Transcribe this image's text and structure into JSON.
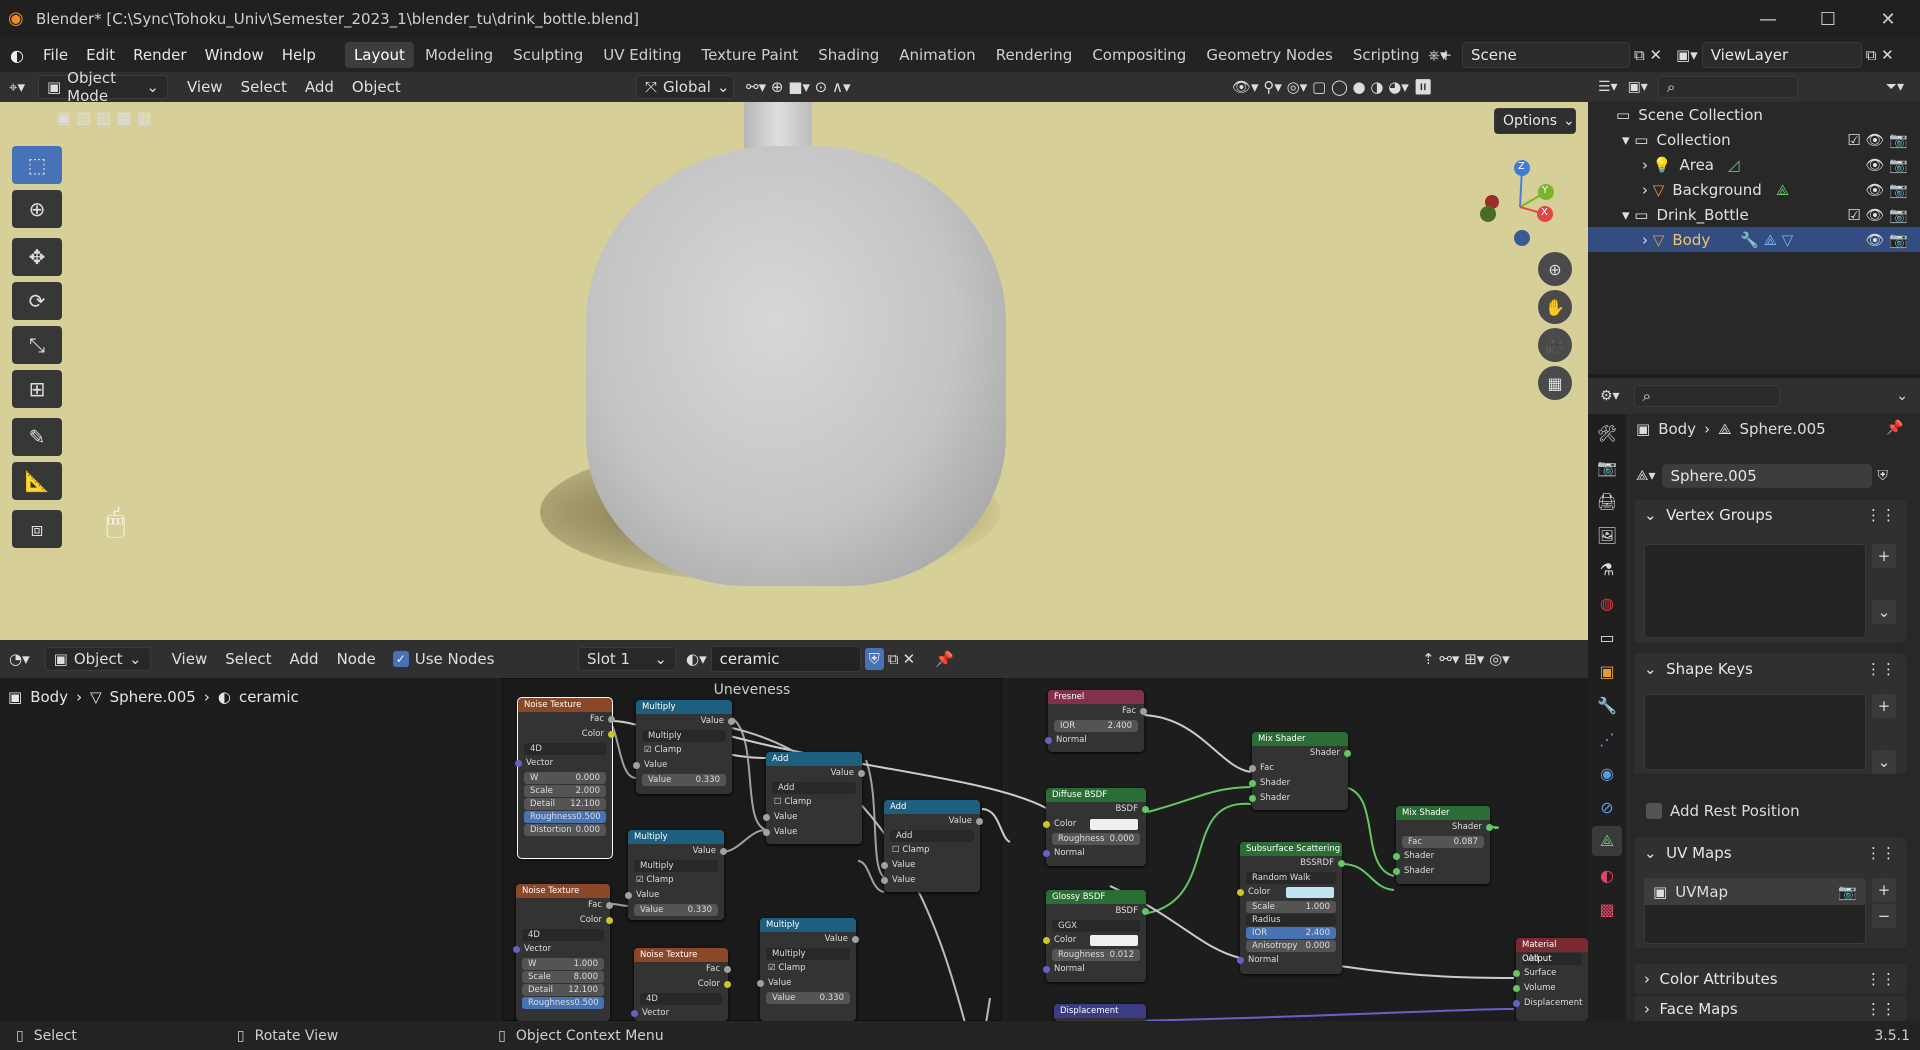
{
  "titlebar": {
    "title": "Blender* [C:\\Sync\\Tohoku_Univ\\Semester_2023_1\\blender_tu\\drink_bottle.blend]"
  },
  "menu": [
    "File",
    "Edit",
    "Render",
    "Window",
    "Help"
  ],
  "workspaces": [
    "Layout",
    "Modeling",
    "Sculpting",
    "UV Editing",
    "Texture Paint",
    "Shading",
    "Animation",
    "Rendering",
    "Compositing",
    "Geometry Nodes",
    "Scripting"
  ],
  "scene": {
    "name": "Scene",
    "view_layer": "ViewLayer"
  },
  "viewport_header": {
    "mode": "Object Mode",
    "items": [
      "View",
      "Select",
      "Add",
      "Object"
    ],
    "transform": "Global",
    "options": "Options"
  },
  "gizmo": {
    "z": "Z",
    "y": "Y",
    "x": "X"
  },
  "node_header": {
    "mode": "Object",
    "items": [
      "View",
      "Select",
      "Add",
      "Node"
    ],
    "use_nodes": "Use Nodes",
    "slot": "Slot 1",
    "material": "ceramic"
  },
  "node_breadcrumb": [
    "Body",
    "Sphere.005",
    "ceramic"
  ],
  "frame_label": "Uneveness",
  "nodes": {
    "noise1": {
      "title": "Noise Texture",
      "out1": "Fac",
      "out2": "Color",
      "dim": "4D",
      "vec": "Vector",
      "w": [
        "W",
        "0.000"
      ],
      "scale": [
        "Scale",
        "2.000"
      ],
      "detail": [
        "Detail",
        "12.100"
      ],
      "rough": [
        "Roughness",
        "0.500"
      ],
      "dist": [
        "Distortion",
        "0.000"
      ]
    },
    "noise2": {
      "title": "Noise Texture",
      "out1": "Fac",
      "out2": "Color",
      "dim": "4D",
      "vec": "Vector",
      "w": [
        "W",
        "1.000"
      ],
      "scale": [
        "Scale",
        "8.000"
      ],
      "detail": [
        "Detail",
        "12.100"
      ],
      "rough": [
        "Roughness",
        "0.500"
      ]
    },
    "noise3": {
      "title": "Noise Texture",
      "out1": "Fac",
      "out2": "Color",
      "dim": "4D",
      "vec": "Vector"
    },
    "mul1": {
      "title": "Multiply",
      "out": "Value",
      "op": "Multiply",
      "clamp": "Clamp",
      "in": "Value",
      "val": [
        "Value",
        "0.330"
      ]
    },
    "mul2": {
      "title": "Multiply",
      "out": "Value",
      "op": "Multiply",
      "clamp": "Clamp",
      "in": "Value",
      "val": [
        "Value",
        "0.330"
      ]
    },
    "mul3": {
      "title": "Multiply",
      "out": "Value",
      "op": "Multiply",
      "clamp": "Clamp",
      "in": "Value",
      "val": [
        "Value",
        "0.330"
      ]
    },
    "add1": {
      "title": "Add",
      "out": "Value",
      "op": "Add",
      "clamp": "Clamp",
      "in1": "Value",
      "in2": "Value"
    },
    "add2": {
      "title": "Add",
      "out": "Value",
      "op": "Add",
      "clamp": "Clamp",
      "in1": "Value",
      "in2": "Value"
    },
    "fresnel": {
      "title": "Fresnel",
      "out": "Fac",
      "ior": [
        "IOR",
        "2.400"
      ],
      "normal": "Normal"
    },
    "diffuse": {
      "title": "Diffuse BSDF",
      "out": "BSDF",
      "color": "Color",
      "rough": [
        "Roughness",
        "0.000"
      ],
      "normal": "Normal"
    },
    "glossy": {
      "title": "Glossy BSDF",
      "out": "BSDF",
      "dist": "GGX",
      "color": "Color",
      "rough": [
        "Roughness",
        "0.012"
      ],
      "normal": "Normal"
    },
    "mix1": {
      "title": "Mix Shader",
      "out": "Shader",
      "fac": "Fac",
      "s1": "Shader",
      "s2": "Shader"
    },
    "mix2": {
      "title": "Mix Shader",
      "out": "Shader",
      "fac": [
        "Fac",
        "0.087"
      ],
      "s1": "Shader",
      "s2": "Shader"
    },
    "sss": {
      "title": "Subsurface Scattering",
      "out": "BSSRDF",
      "method": "Random Walk",
      "color": "Color",
      "scale": [
        "Scale",
        "1.000"
      ],
      "radius": "Radius",
      "ior": [
        "IOR",
        "2.400"
      ],
      "aniso": [
        "Anisotropy",
        "0.000"
      ],
      "normal": "Normal"
    },
    "output": {
      "title": "Material Output",
      "target": "All",
      "surface": "Surface",
      "volume": "Volume",
      "disp": "Displacement"
    },
    "displacement": {
      "title": "Displacement"
    }
  },
  "outliner": {
    "scene_collection": "Scene Collection",
    "rows": [
      {
        "label": "Collection"
      },
      {
        "label": "Area"
      },
      {
        "label": "Background"
      },
      {
        "label": "Drink_Bottle"
      },
      {
        "label": "Body"
      }
    ]
  },
  "properties": {
    "breadcrumb_obj": "Body",
    "breadcrumb_mesh": "Sphere.005",
    "mesh_name": "Sphere.005",
    "panels": {
      "vertex_groups": "Vertex Groups",
      "shape_keys": "Shape Keys",
      "add_rest": "Add Rest Position",
      "uv_maps": "UV Maps",
      "uvmap": "UVMap",
      "color_attr": "Color Attributes",
      "face_maps": "Face Maps"
    }
  },
  "status": {
    "select": "Select",
    "rotate": "Rotate View",
    "context": "Object Context Menu",
    "version": "3.5.1"
  },
  "colors": {
    "accent": "#4772b3",
    "viewport_bg": "#d6cf97"
  }
}
